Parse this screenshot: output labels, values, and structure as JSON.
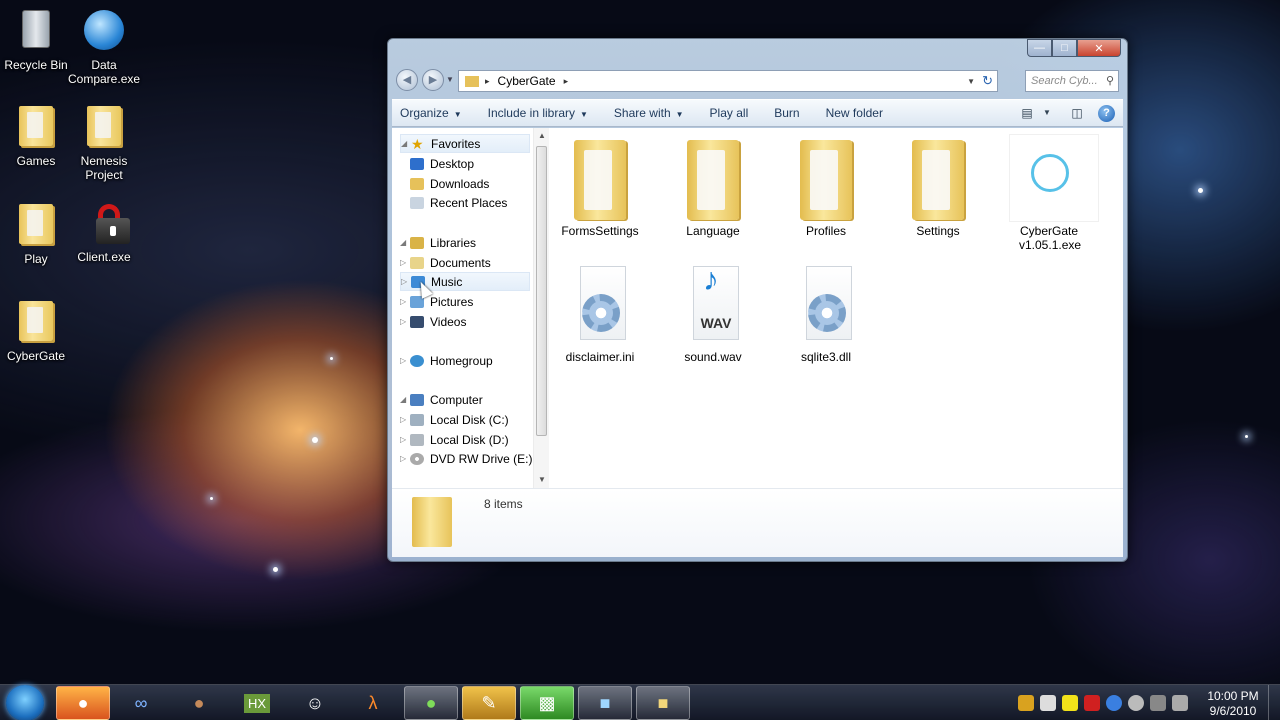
{
  "desktop": {
    "icons": [
      {
        "label": "Recycle Bin"
      },
      {
        "label": "Data Compare.exe"
      },
      {
        "label": "Games"
      },
      {
        "label": "Nemesis Project"
      },
      {
        "label": "Play"
      },
      {
        "label": "Client.exe"
      },
      {
        "label": "CyberGate"
      }
    ]
  },
  "window": {
    "address": {
      "path": "CyberGate",
      "separator": "▸"
    },
    "search": {
      "placeholder": "Search Cyb..."
    },
    "toolbar": {
      "organize": "Organize",
      "include_in_library": "Include in library",
      "share_with": "Share with",
      "play_all": "Play all",
      "burn": "Burn",
      "new_folder": "New folder"
    },
    "nav": {
      "favorites": "Favorites",
      "desktop": "Desktop",
      "downloads": "Downloads",
      "recent_places": "Recent Places",
      "libraries": "Libraries",
      "documents": "Documents",
      "music": "Music",
      "pictures": "Pictures",
      "videos": "Videos",
      "homegroup": "Homegroup",
      "computer": "Computer",
      "local_c": "Local Disk (C:)",
      "local_d": "Local Disk (D:)",
      "dvd_e": "DVD RW Drive (E:)"
    },
    "files": [
      {
        "name": "FormsSettings",
        "type": "folder"
      },
      {
        "name": "Language",
        "type": "folder"
      },
      {
        "name": "Profiles",
        "type": "folder"
      },
      {
        "name": "Settings",
        "type": "folder"
      },
      {
        "name": "CyberGate v1.05.1.exe",
        "type": "exe"
      },
      {
        "name": "disclaimer.ini",
        "type": "ini"
      },
      {
        "name": "sound.wav",
        "type": "wav",
        "badge": "WAV"
      },
      {
        "name": "sqlite3.dll",
        "type": "dll"
      }
    ],
    "details": {
      "item_count": "8 items"
    }
  },
  "taskbar": {
    "clock_time": "10:00 PM",
    "clock_date": "9/6/2010"
  },
  "colors": {
    "toolbar_text": "#1e395b",
    "folder_yellow": "#f2d67a",
    "cybergate_ring": "#57c1e8"
  }
}
